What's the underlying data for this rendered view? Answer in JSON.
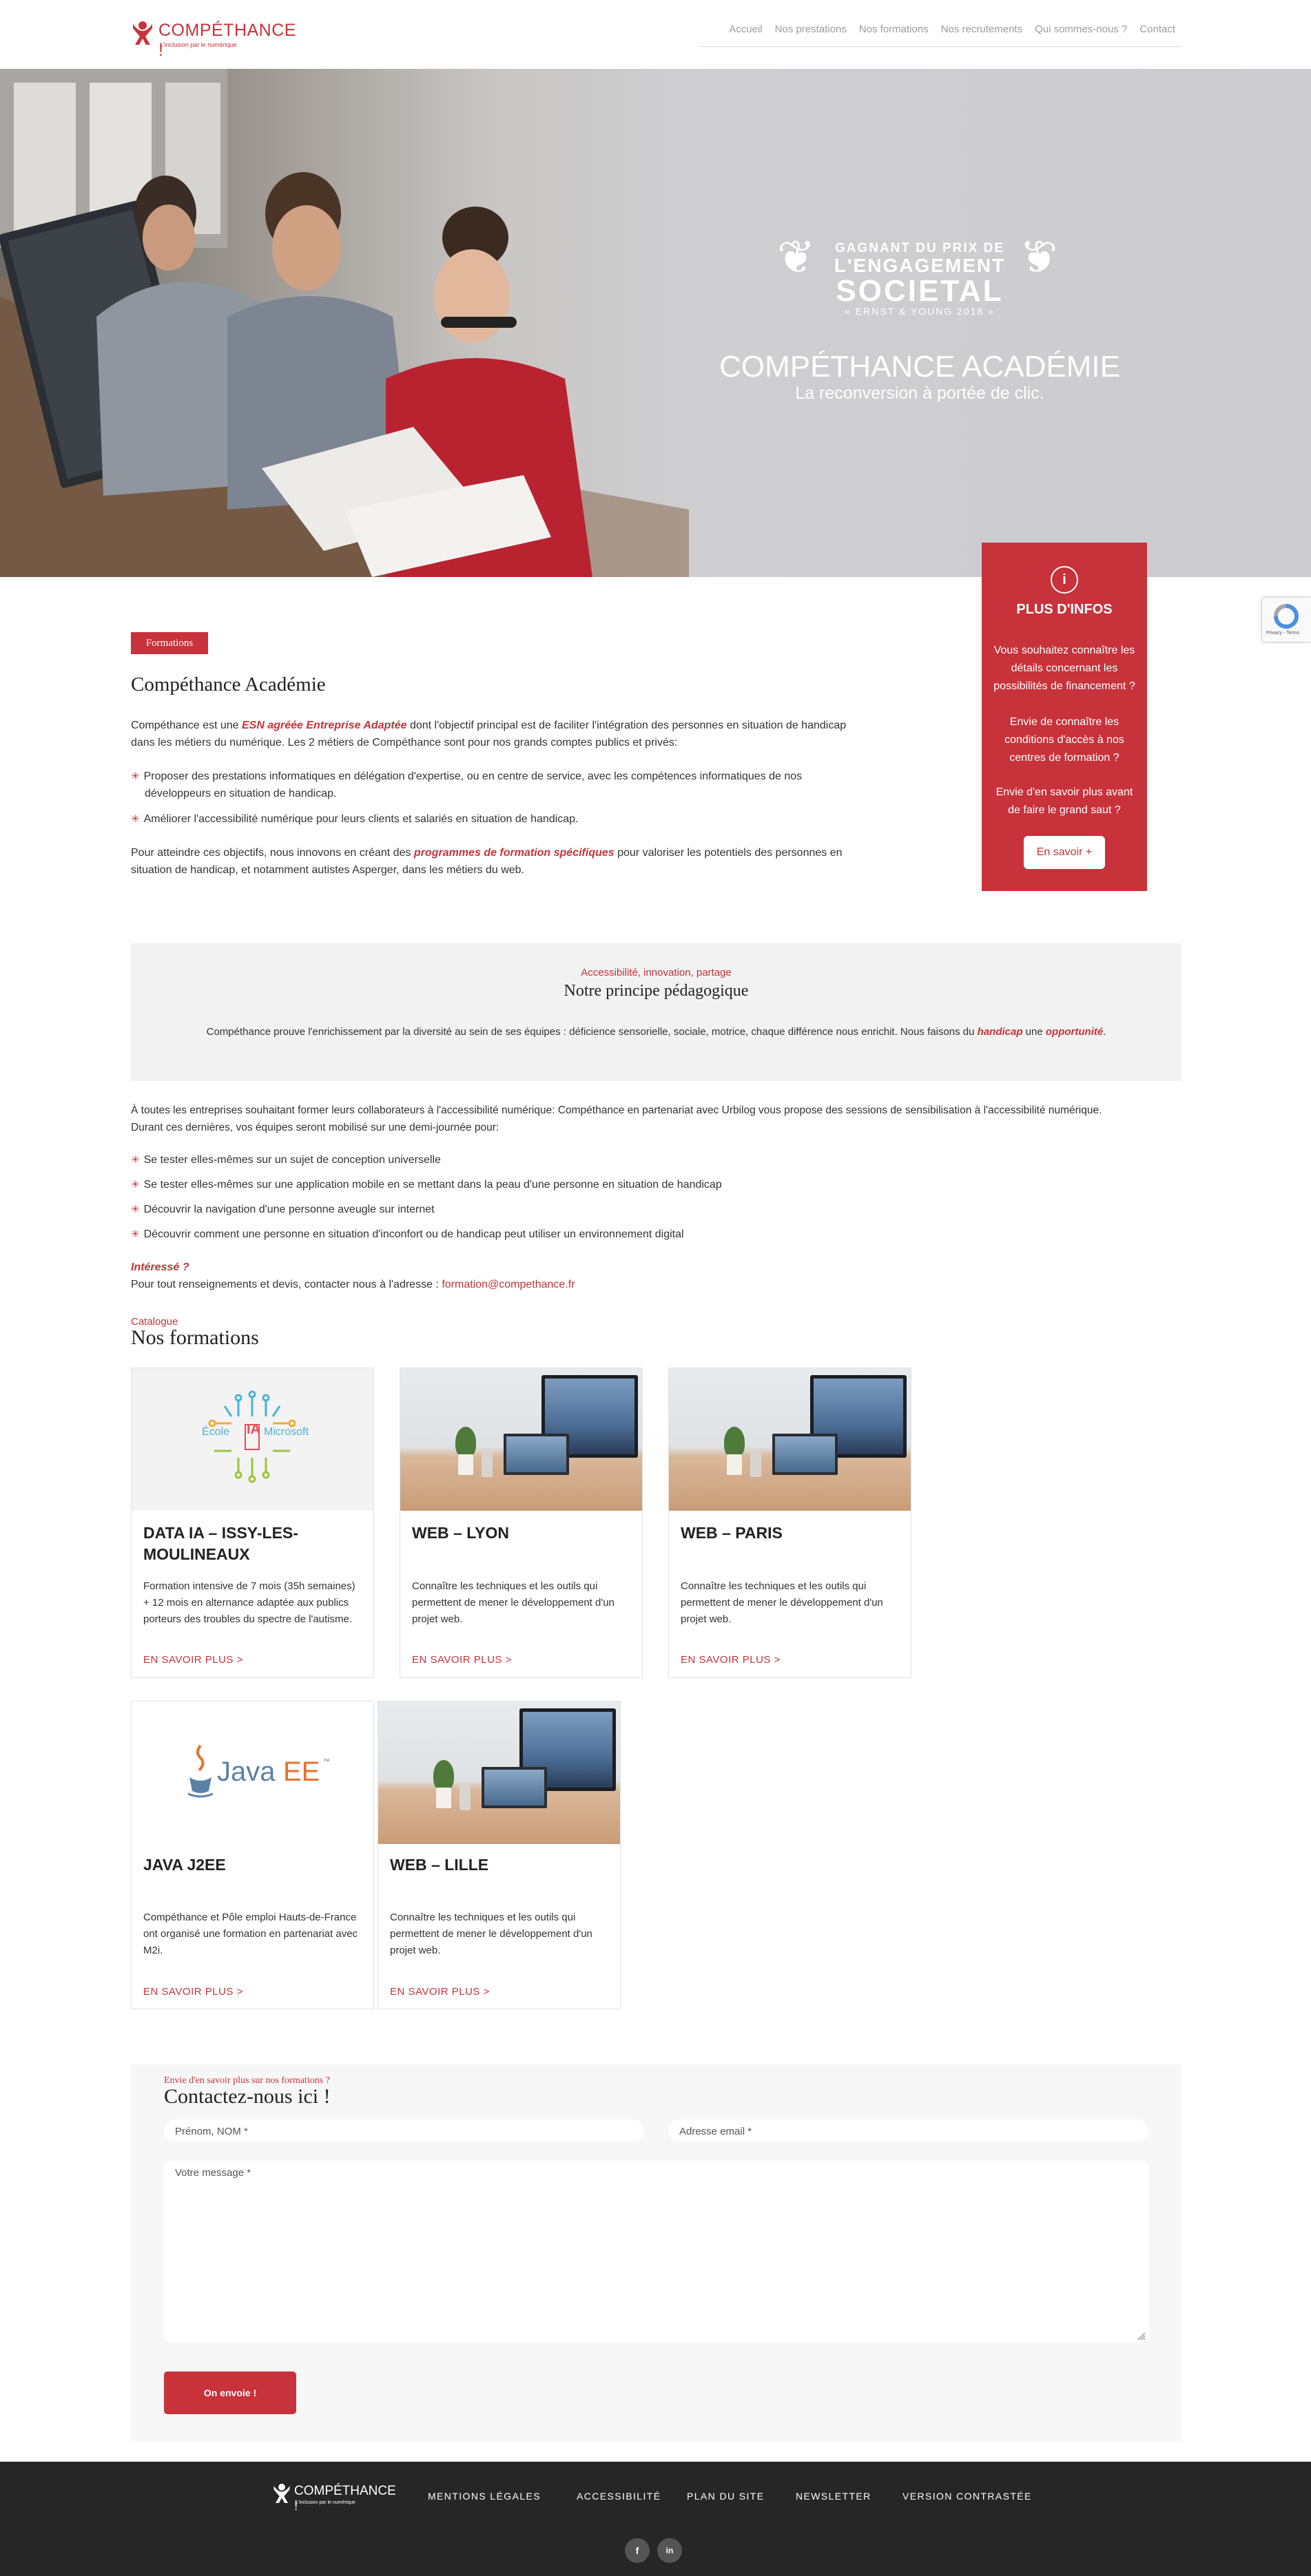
{
  "brand": {
    "name": "COMPÉTHANCE !",
    "tagline": "L'inclusion par le numérique",
    "accent_color": "#c8323a",
    "icon": "person-icon"
  },
  "nav": {
    "items": [
      "Accueil",
      "Nos prestations",
      "Nos formations",
      "Nos recrutements",
      "Qui sommes-nous ?",
      "Contact"
    ]
  },
  "hero": {
    "award": {
      "line1": "GAGNANT DU PRIX DE",
      "line2": "L'ENGAGEMENT",
      "line3": "SOCIETAL",
      "line4": "« ERNST & YOUNG 2018 »"
    },
    "title": "COMPÉTHANCE ACADÉMIE",
    "subtitle": "La reconversion à portée de clic."
  },
  "infobox": {
    "icon": "info-icon",
    "title": "PLUS D'INFOS",
    "p1": "Vous souhaitez connaître les détails concernant les possibilités de financement ?",
    "p2": "Envie de connaître les conditions d'accès à nos centres de formation ?",
    "p3": "Envie d'en savoir plus avant de faire le grand saut ?",
    "button": "En savoir +"
  },
  "intro": {
    "tag": "Formations",
    "heading": "Compéthance Académie",
    "p1_a": "Compéthance est une ",
    "p1_em": "ESN agréée Entreprise Adaptée",
    "p1_b": " dont l'objectif principal est de faciliter l'intégration des personnes en situation de handicap",
    "p1_c": "dans les métiers du numérique. Les 2 métiers de Compéthance sont pour nos grands comptes publics et privés:",
    "bullet1_a": "Proposer des prestations informatiques en délégation d'expertise, ou en centre de service, avec les compétences informatiques de nos",
    "bullet1_b": "développeurs en situation de handicap.",
    "bullet2": "Améliorer l'accessibilité numérique pour leurs clients et salariés en situation de handicap.",
    "p2_a": "Pour atteindre ces objectifs, nous innovons en créant des ",
    "p2_em": "programmes de formation spécifiques",
    "p2_b": " pour valoriser les potentiels des personnes en",
    "p2_c": "situation de handicap, et notamment autistes Asperger, dans les métiers du web."
  },
  "pedagogy": {
    "kicker": "Accessibilité, innovation, partage",
    "title": "Notre principe pédagogique",
    "text_a": "Compéthance prouve l'enrichissement par la diversité au sein de ses équipes : déficience sensorielle, sociale, motrice, chaque différence nous enrichit. Nous faisons du ",
    "em1": "handicap",
    "text_b": " une ",
    "em2": "opportunité",
    "text_c": "."
  },
  "awareness": {
    "p1": "À toutes les entreprises souhaitant former leurs collaborateurs à l'accessibilité numérique: Compéthance en partenariat avec Urbilog vous propose des sessions de sensibilisation à l'accessibilité numérique.",
    "p2": "Durant ces dernières, vos équipes seront mobilisé sur une demi-journée pour:",
    "items": [
      "Se tester elles-mêmes sur un sujet de conception universelle",
      "Se tester elles-mêmes sur une application mobile en se mettant dans la peau d'une personne en situation de handicap",
      "Découvrir la navigation d'une personne aveugle sur internet",
      "Découvrir comment une personne en situation d'inconfort ou de handicap peut utiliser un environnement digital"
    ],
    "interest": "Intéressé ?",
    "contact_text": "Pour tout renseignements et devis, contacter nous à l'adresse : ",
    "email": "formation@compethance.fr"
  },
  "catalog": {
    "kicker": "Catalogue",
    "title": "Nos formations",
    "more": "EN SAVOIR PLUS >",
    "cards": [
      {
        "title": "DATA IA – ISSY-LES-MOULINEAUX",
        "desc": "Formation intensive de 7 mois (35h semaines) + 12 mois en alternance adaptée aux publics porteurs des troubles du spectre de l'autisme.",
        "logo_a": "École",
        "logo_b": "IA",
        "logo_c": "Microsoft"
      },
      {
        "title": "WEB – LYON",
        "desc": "Connaître les techniques et les outils qui permettent de mener le développement d'un projet web."
      },
      {
        "title": "WEB – PARIS",
        "desc": "Connaître les techniques et les outils qui permettent de mener le développement d'un projet web."
      },
      {
        "title": "JAVA J2EE",
        "desc": "Compéthance et Pôle emploi Hauts-de-France ont organisé une formation en partenariat avec M2i.",
        "logo_a": "Java",
        "logo_b": "EE",
        "logo_c": "™"
      },
      {
        "title": "WEB – LILLE",
        "desc": "Connaître les techniques et les outils qui permettent de mener le développement d'un projet web."
      }
    ]
  },
  "contact": {
    "kicker": "Envie d'en savoir plus sur nos formations ?",
    "title": "Contactez-nous ici !",
    "name_placeholder": "Prénom, NOM *",
    "email_placeholder": "Adresse email *",
    "message_placeholder": "Votre message *",
    "submit": "On envoie !"
  },
  "footer": {
    "links": [
      "MENTIONS LÉGALES",
      "ACCESSIBILITÉ",
      "PLAN DU SITE",
      "NEWSLETTER",
      "VERSION CONTRASTÉE"
    ],
    "social": [
      {
        "icon": "facebook-icon",
        "label": "f"
      },
      {
        "icon": "linkedin-icon",
        "label": "in"
      }
    ]
  },
  "recaptcha": {
    "text": "Privacy - Terms"
  }
}
